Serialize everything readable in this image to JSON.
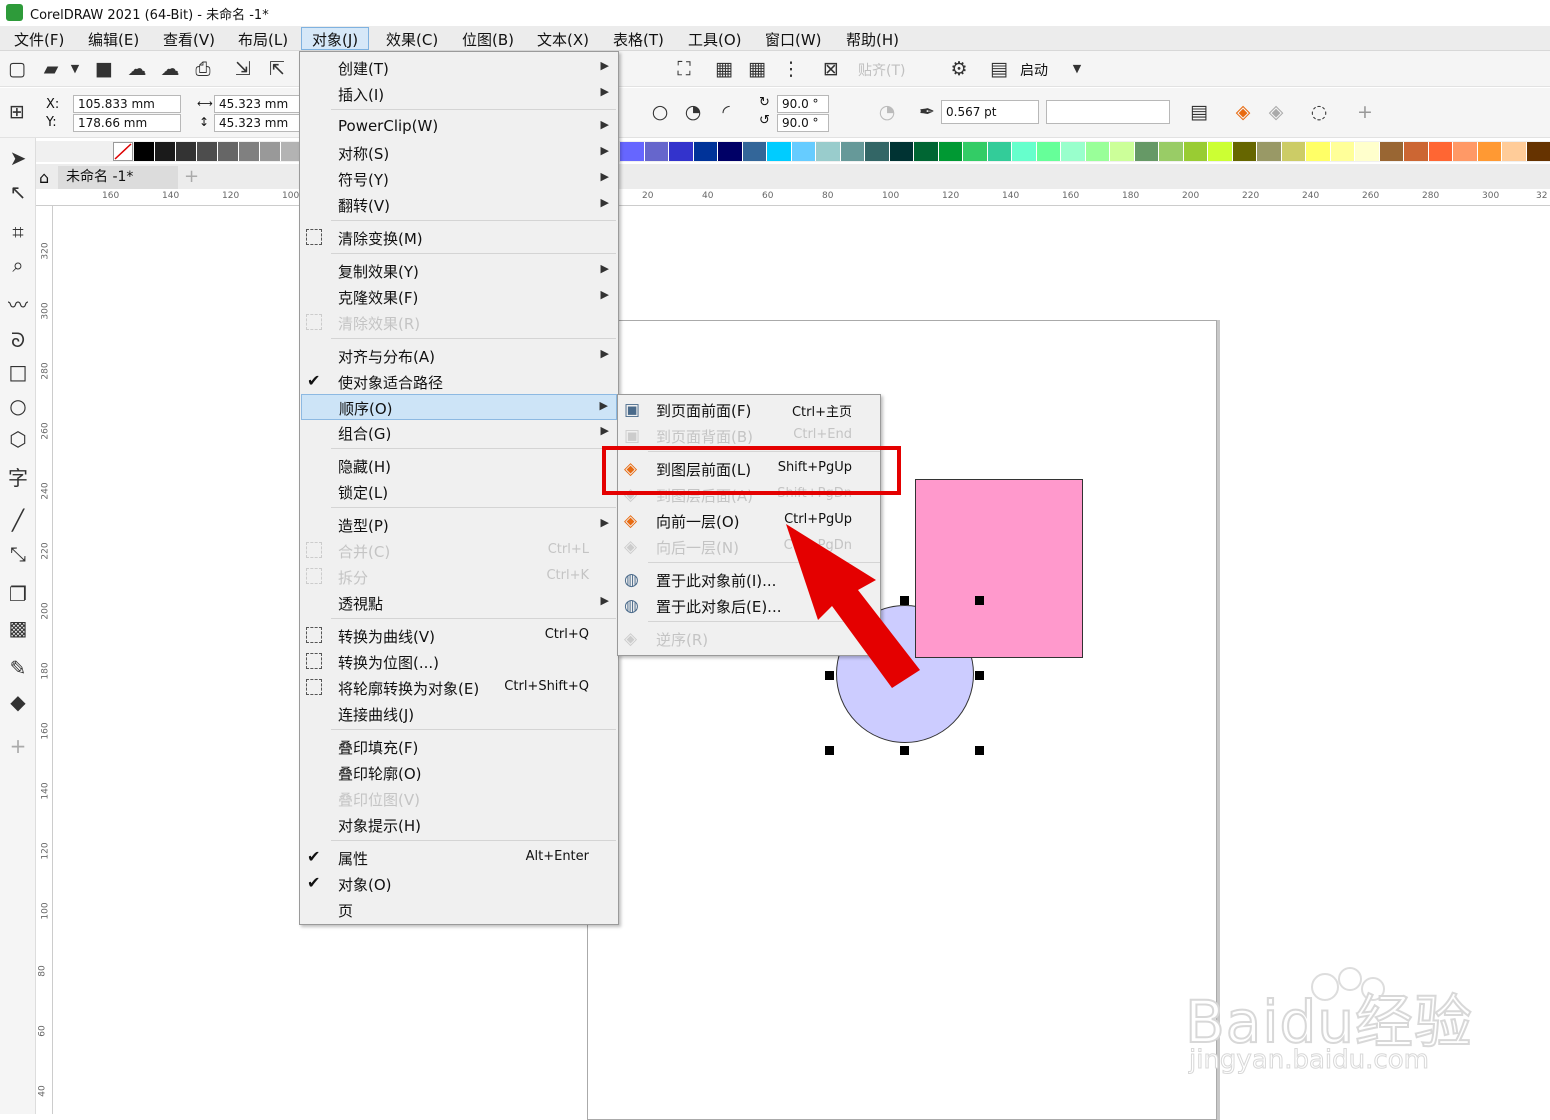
{
  "window": {
    "title": "CorelDRAW 2021 (64-Bit) - 未命名 -1*"
  },
  "menubar": [
    "文件(F)",
    "编辑(E)",
    "查看(V)",
    "布局(L)",
    "对象(J)",
    "效果(C)",
    "位图(B)",
    "文本(X)",
    "表格(T)",
    "工具(O)",
    "窗口(W)",
    "帮助(H)"
  ],
  "toolbar": {
    "snap_label": "贴齐(T)",
    "launch_label": "启动"
  },
  "props": {
    "x_label": "X:",
    "y_label": "Y:",
    "x_value": "105.833 mm",
    "y_value": "178.66 mm",
    "w_value": "45.323 mm",
    "h_value": "45.323 mm",
    "angle1": "90.0 °",
    "angle2": "90.0 °",
    "outline": "0.567 pt"
  },
  "doc_tab": "未命名 -1*",
  "ruler_h": [
    "160",
    "140",
    "120",
    "100",
    "20",
    "40",
    "60",
    "80",
    "100",
    "120",
    "140",
    "160",
    "180",
    "200",
    "220",
    "240",
    "260",
    "280",
    "300",
    "32"
  ],
  "ruler_v": [
    "320",
    "300",
    "280",
    "260",
    "240",
    "220",
    "200",
    "180",
    "160",
    "140",
    "120",
    "100",
    "80",
    "60",
    "40"
  ],
  "menu": [
    {
      "label": "创建(T)",
      "arrow": true
    },
    {
      "label": "插入(I)",
      "arrow": true
    },
    {
      "label": "PowerClip(W)",
      "arrow": true
    },
    {
      "label": "对称(S)",
      "arrow": true
    },
    {
      "label": "符号(Y)",
      "arrow": true
    },
    {
      "label": "翻转(V)",
      "arrow": true
    },
    {
      "label": "清除变换(M)"
    },
    {
      "label": "复制效果(Y)",
      "arrow": true
    },
    {
      "label": "克隆效果(F)",
      "arrow": true
    },
    {
      "label": "清除效果(R)",
      "disabled": true
    },
    {
      "label": "对齐与分布(A)",
      "arrow": true
    },
    {
      "label": "使对象适合路径",
      "checked": true
    },
    {
      "label": "顺序(O)",
      "arrow": true,
      "highlighted": true
    },
    {
      "label": "组合(G)",
      "arrow": true
    },
    {
      "label": "隐藏(H)"
    },
    {
      "label": "锁定(L)"
    },
    {
      "label": "造型(P)",
      "arrow": true
    },
    {
      "label": "合并(C)",
      "shortcut": "Ctrl+L",
      "disabled": true
    },
    {
      "label": "拆分",
      "shortcut": "Ctrl+K",
      "disabled": true
    },
    {
      "label": "透視點",
      "arrow": true
    },
    {
      "label": "转换为曲线(V)",
      "shortcut": "Ctrl+Q"
    },
    {
      "label": "转换为位图(...)"
    },
    {
      "label": "将轮廓转换为对象(E)",
      "shortcut": "Ctrl+Shift+Q"
    },
    {
      "label": "连接曲线(J)"
    },
    {
      "label": "叠印填充(F)"
    },
    {
      "label": "叠印轮廓(O)"
    },
    {
      "label": "叠印位图(V)",
      "disabled": true
    },
    {
      "label": "对象提示(H)"
    },
    {
      "label": "属性",
      "shortcut": "Alt+Enter",
      "checked": true
    },
    {
      "label": "对象(O)",
      "checked": true
    },
    {
      "label": "页"
    }
  ],
  "submenu": [
    {
      "label": "到页面前面(F)",
      "shortcut": "Ctrl+主页"
    },
    {
      "label": "到页面背面(B)",
      "shortcut": "Ctrl+End",
      "disabled": true
    },
    {
      "label": "到图层前面(L)",
      "shortcut": "Shift+PgUp"
    },
    {
      "label": "到图层后面(A)",
      "shortcut": "Shift+PgDn",
      "disabled": true
    },
    {
      "label": "向前一层(O)",
      "shortcut": "Ctrl+PgUp"
    },
    {
      "label": "向后一层(N)",
      "shortcut": "Ctrl+PgDn",
      "disabled": true
    },
    {
      "label": "置于此对象前(I)..."
    },
    {
      "label": "置于此对象后(E)..."
    },
    {
      "label": "逆序(R)",
      "disabled": true
    }
  ],
  "watermark": {
    "brand": "Baidu经验",
    "url": "jingyan.baidu.com"
  },
  "colors": {
    "accent": "#e40000",
    "circle": "#ccccff",
    "square": "#ff99cc"
  }
}
